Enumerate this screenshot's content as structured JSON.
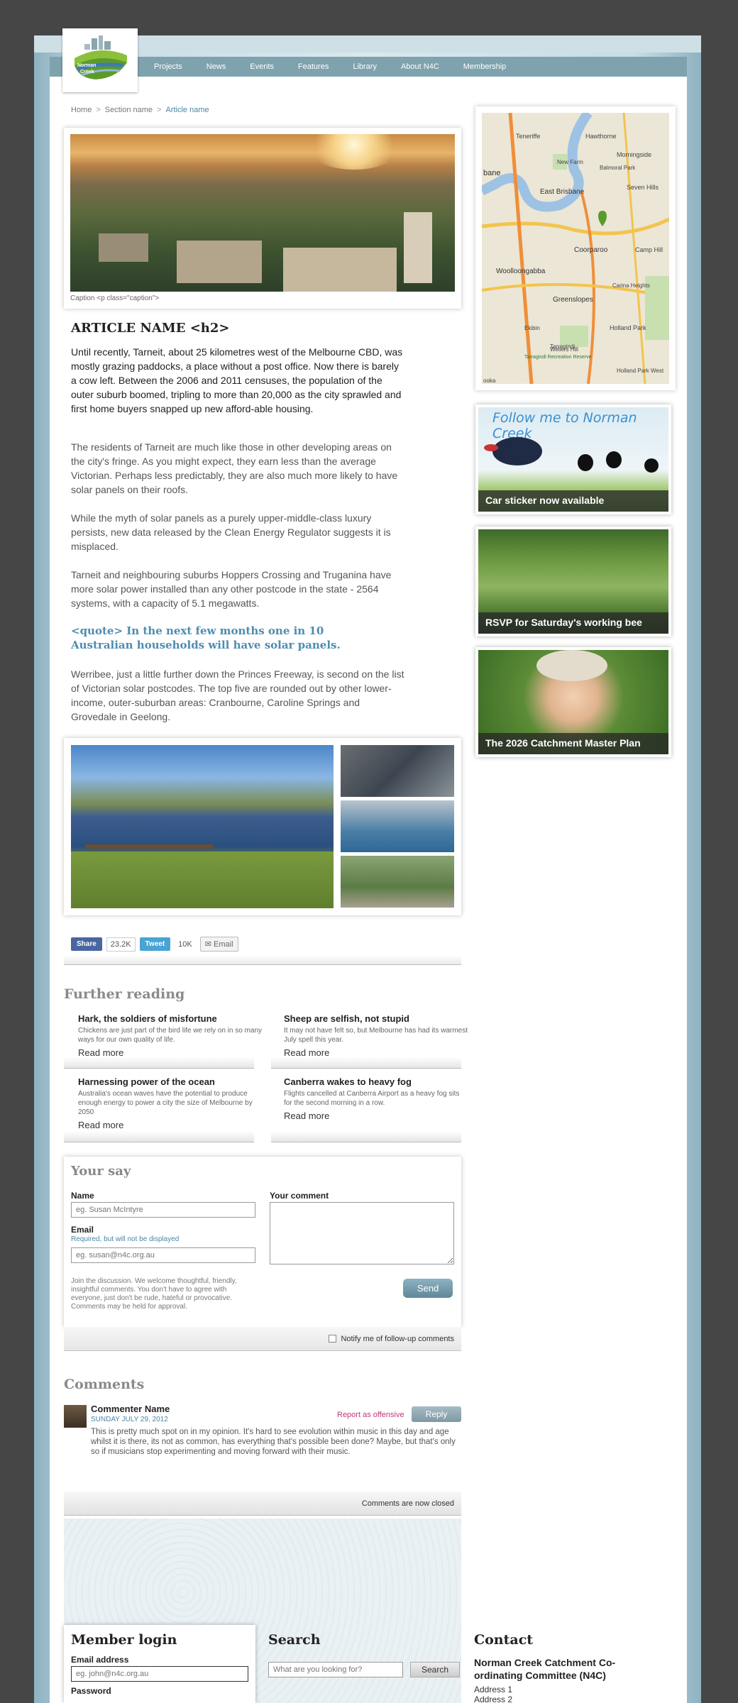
{
  "nav": {
    "items": [
      "Projects",
      "News",
      "Events",
      "Features",
      "Library",
      "About N4C",
      "Membership"
    ]
  },
  "logo": {
    "text": "Norman Creek"
  },
  "breadcrumb": {
    "home": "Home",
    "section": "Section name",
    "current": "Article name"
  },
  "article": {
    "caption": "Caption <p class=\"caption\">",
    "title": "ARTICLE NAME <h2>",
    "p1": "Until recently, Tarneit, about 25 kilometres west of the Melbourne CBD, was mostly grazing paddocks, a place without a post office. Now there is barely a cow left. Between the 2006 and 2011 censuses, the population of the outer suburb boomed, tripling to more than 20,000 as the city sprawled and first home buyers snapped up new afford-able housing.",
    "p2": "The residents of Tarneit are much like those in other developing areas on the city's fringe. As you might expect, they earn less than the average Victorian. Perhaps less predictably, they are also much more likely to have solar panels on their roofs.",
    "p3": "While the myth of solar panels as a purely upper-middle-class luxury persists, new data released by the Clean Energy Regulator suggests it is misplaced.",
    "p4": "Tarneit and neighbouring suburbs Hoppers Crossing and Truganina have more solar power installed than any other postcode in the state - 2564 systems, with a capacity of 5.1 megawatts.",
    "quote": "<quote> In the next few months one in 10 Australian households will have solar panels.",
    "p5": "Werribee, just a little further down the Princes Freeway, is second on the list of Victorian solar postcodes. The top five are rounded out by other lower-income, outer-suburban areas: Cranbourne, Caroline Springs and Grovedale in Geelong."
  },
  "share": {
    "facebook_label": "Share",
    "facebook_count": "23.2K",
    "tweet_label": "Tweet",
    "tweet_count": "10K",
    "email_label": "Email"
  },
  "further_reading": {
    "title": "Further reading",
    "items": [
      {
        "title": "Hark, the soldiers of misfortune",
        "summary": "Chickens are just part of the bird life we rely on in so many ways for our own quality of life.",
        "more": "Read more"
      },
      {
        "title": "Sheep are selfish, not stupid",
        "summary": "It may not have felt so, but Melbourne has had its warmest July spell this year.",
        "more": "Read more"
      },
      {
        "title": "Harnessing power of the ocean",
        "summary": "Australia's ocean waves have the potential to produce enough energy to power a city the size of Melbourne by 2050",
        "more": "Read more"
      },
      {
        "title": "Canberra wakes to heavy fog",
        "summary": "Flights cancelled at Canberra Airport as a heavy fog sits for the second morning in a row.",
        "more": "Read more"
      }
    ]
  },
  "your_say": {
    "title": "Your say",
    "name_label": "Name",
    "name_placeholder": "eg. Susan McIntyre",
    "email_label": "Email",
    "email_note": "Required, but will not be displayed",
    "email_placeholder": "eg. susan@n4c.org.au",
    "comment_label": "Your comment",
    "join_text": "Join the discussion. We welcome thoughtful, friendly, insightful comments. You don't have to agree with everyone, just don't be rude, hateful or provocative. Comments may be held for approval.",
    "send_label": "Send",
    "notify_label": "Notify me of follow-up comments"
  },
  "comments": {
    "title": "Comments",
    "items": [
      {
        "name": "Commenter Name",
        "date": "SUNDAY JULY 29, 2012",
        "report": "Report as offensive",
        "reply": "Reply",
        "text": "This is pretty much spot on in my opinion. It's hard to see evolution within music in this day and age whilst it is there, its not as common, has everything that's possible been done? Maybe, but that's only so if musicians stop experimenting and moving forward with their music."
      }
    ],
    "closed_label": "Comments are now closed"
  },
  "map": {
    "labels": [
      "Teneriffe",
      "Hawthorne",
      "Morningside",
      "New Farm",
      "Balmoral Park",
      "bane",
      "East Brisbane",
      "Seven Hills",
      "Coorparoo",
      "Camp Hill",
      "Woolloongabba",
      "Greenslopes",
      "Holland Park",
      "Ekibin",
      "Tarragindi",
      "Wellers Hill",
      "Holland Park West",
      "Tarragindi Recreation Reserve",
      "Carina Heights",
      "ooka"
    ]
  },
  "promos": [
    {
      "label": "Car sticker now available",
      "banner": "Follow me to Norman Creek"
    },
    {
      "label": "RSVP for Saturday's working bee"
    },
    {
      "label": "The 2026 Catchment Master Plan"
    }
  ],
  "footer": {
    "login_title": "Member login",
    "email_label": "Email address",
    "email_placeholder": "eg. john@n4c.org.au",
    "password_label": "Password",
    "search_title": "Search",
    "search_placeholder": "What are you looking for?",
    "search_button": "Search",
    "contact_title": "Contact",
    "org_name": "Norman Creek Catchment Co-ordinating Committee (N4C)",
    "address1": "Address 1",
    "address2": "Address 2"
  }
}
